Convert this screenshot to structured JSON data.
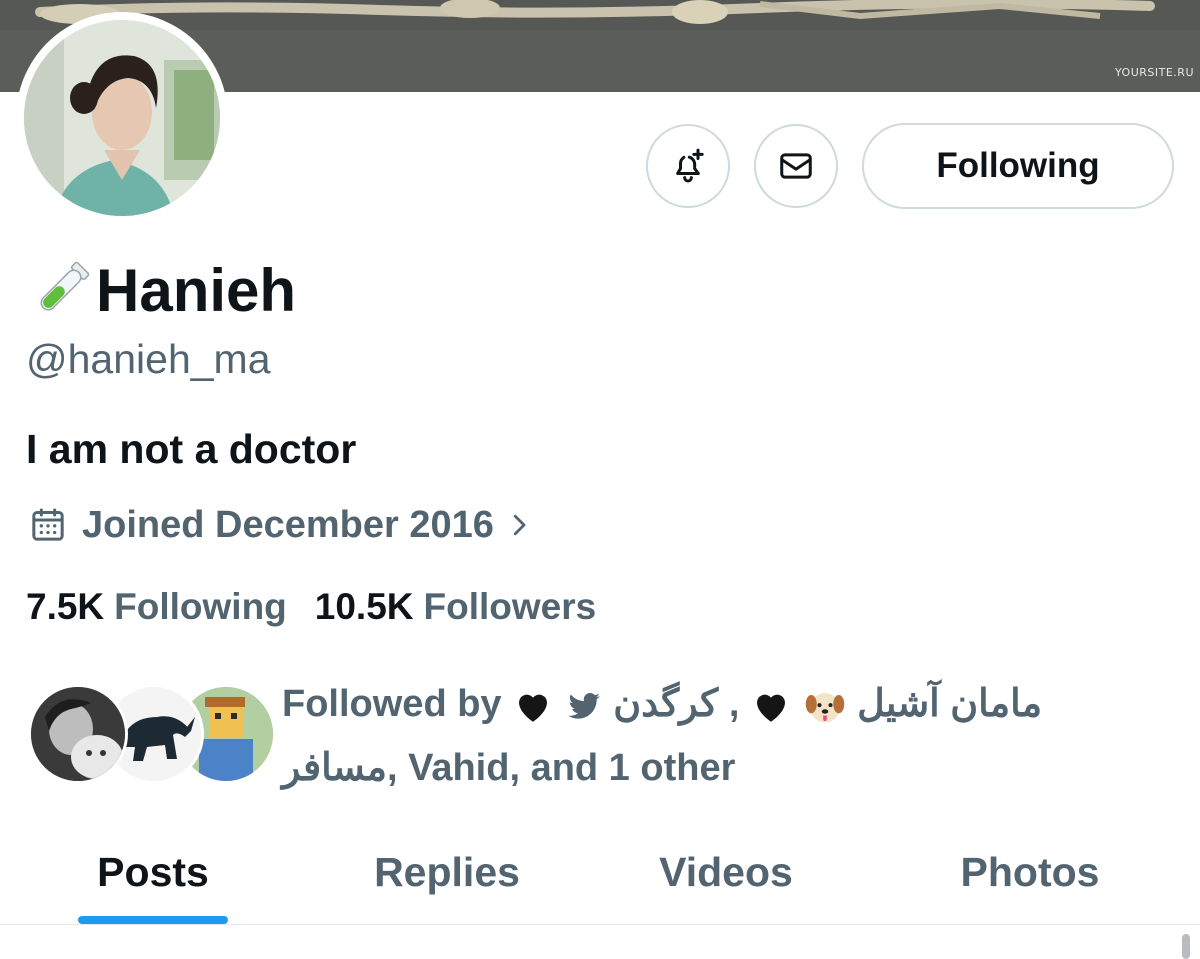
{
  "banner": {
    "watermark": "YOURSITE.RU"
  },
  "profile": {
    "name_emoji_icon": "test-tube-icon",
    "name": "Hanieh",
    "handle": "@hanieh_ma",
    "bio": "I am not a doctor",
    "joined": "Joined December 2016",
    "following_count": "7.5K",
    "following_label": "Following",
    "followers_count": "10.5K",
    "followers_label": "Followers"
  },
  "actions": {
    "notify_icon": "bell-plus-icon",
    "message_icon": "envelope-icon",
    "follow_button_label": "Following"
  },
  "followed_by": {
    "prefix": "Followed by",
    "name_1": "مامان آشیل",
    "name_2": "کرگدن",
    "name_3": "مسافر",
    "suffix": ", Vahid, and 1 other",
    "separator": " ,"
  },
  "tabs": [
    "Posts",
    "Replies",
    "Videos",
    "Photos"
  ],
  "colors": {
    "accent": "#1d9bf0",
    "secondary_text": "#536471",
    "primary_text": "#0f1419",
    "border": "#cfd9de"
  }
}
